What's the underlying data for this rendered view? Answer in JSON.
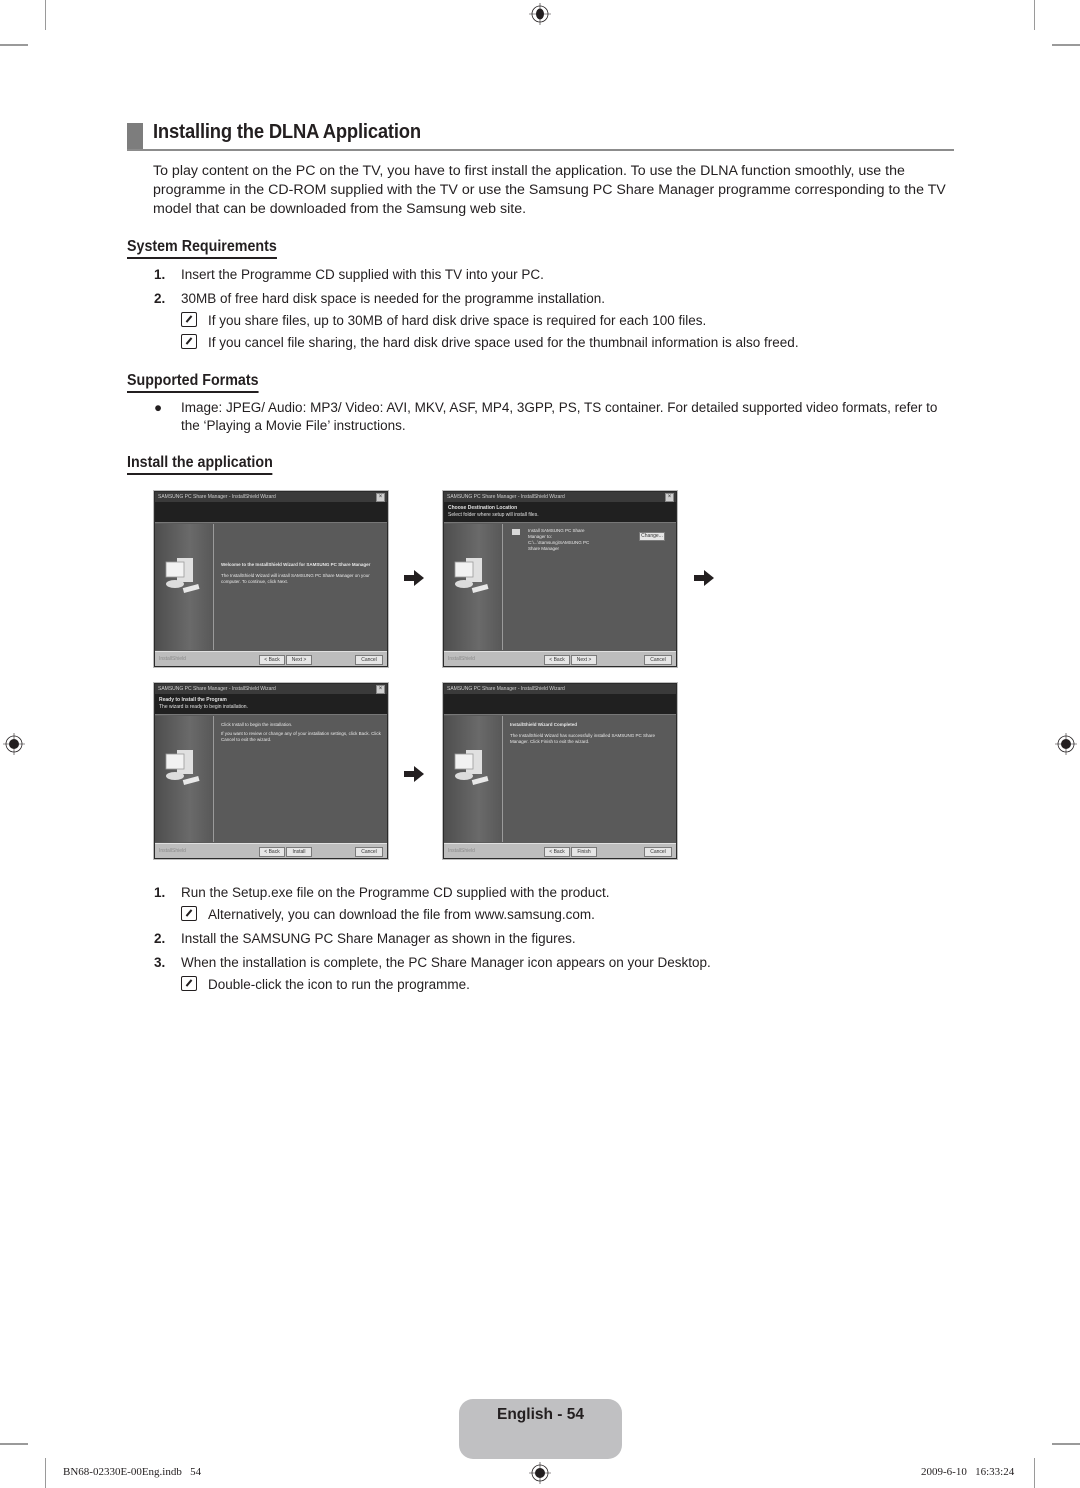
{
  "heading": {
    "title": "Installing the DLNA Application",
    "intro": "To play content on the PC on the TV, you have to first install the application. To use the DLNA function smoothly, use the programme in the CD-ROM supplied with the TV or use the Samsung PC Share Manager programme corresponding to the TV model that can be downloaded from the Samsung web site."
  },
  "system_requirements": {
    "title": "System Requirements",
    "items": [
      {
        "num": "1.",
        "text": "Insert the Programme CD supplied with this TV into your PC."
      },
      {
        "num": "2.",
        "text": "30MB of free hard disk space is needed for the programme installation."
      }
    ],
    "notes": [
      "If you share files, up to 30MB of hard disk drive space is required for each 100 files.",
      "If you cancel file sharing, the hard disk drive space used for the thumbnail information is also freed."
    ]
  },
  "supported_formats": {
    "title": "Supported Formats",
    "bullet_symbol": "●",
    "text": "Image: JPEG/ Audio: MP3/ Video: AVI, MKV, ASF, MP4, 3GPP, PS, TS container. For detailed supported video formats, refer to the ‘Playing a Movie File’ instructions."
  },
  "install_app": {
    "title": "Install the application",
    "wizards": [
      {
        "window_title": "SAMSUNG PC Share Manager - InstallShield Wizard",
        "banner_title": "",
        "banner_sub": "",
        "body_lines": [
          "Welcome to the InstallShield Wizard for SAMSUNG PC Share Manager",
          "The InstallShield Wizard will install SAMSUNG PC Share Manager on your computer. To continue, click Next."
        ],
        "buttons": {
          "back": "< Back",
          "next": "Next >",
          "cancel": "Cancel"
        },
        "brand": "InstallShield"
      },
      {
        "window_title": "SAMSUNG PC Share Manager - InstallShield Wizard",
        "banner_title": "Choose Destination Location",
        "banner_sub": "Select folder where setup will install files.",
        "body_lines": [
          "Install SAMSUNG PC Share Manager to:",
          "C:\\...\\Samsung\\SAMSUNG PC Share Manager"
        ],
        "change_button": "Change...",
        "buttons": {
          "back": "< Back",
          "next": "Next >",
          "cancel": "Cancel"
        },
        "brand": "InstallShield"
      },
      {
        "window_title": "SAMSUNG PC Share Manager - InstallShield Wizard",
        "banner_title": "Ready to Install the Program",
        "banner_sub": "The wizard is ready to begin installation.",
        "body_lines": [
          "Click Install to begin the installation.",
          "If you want to review or change any of your installation settings, click Back. Click Cancel to exit the wizard."
        ],
        "buttons": {
          "back": "< Back",
          "next": "Install",
          "cancel": "Cancel"
        },
        "brand": "InstallShield"
      },
      {
        "window_title": "SAMSUNG PC Share Manager - InstallShield Wizard",
        "banner_title": "",
        "banner_sub": "",
        "body_lines": [
          "InstallShield Wizard Completed",
          "The InstallShield Wizard has successfully installed SAMSUNG PC Share Manager. Click Finish to exit the wizard."
        ],
        "buttons": {
          "back": "< Back",
          "next": "Finish",
          "cancel": "Cancel"
        },
        "brand": "InstallShield"
      }
    ],
    "steps": [
      {
        "num": "1.",
        "text": "Run the Setup.exe file on the Programme CD supplied with the product."
      },
      {
        "note": "Alternatively, you can download the file from www.samsung.com."
      },
      {
        "num": "2.",
        "text": "Install the SAMSUNG PC Share Manager as shown in the figures."
      },
      {
        "num": "3.",
        "text": "When the installation is complete, the PC Share Manager icon appears on your Desktop."
      },
      {
        "note": "Double-click the icon to run the programme."
      }
    ]
  },
  "footer": {
    "page_label": "English - 54",
    "file_slug": "BN68-02330E-00Eng.indb   54",
    "timestamp": "2009-6-10   16:33:24"
  },
  "colors": {
    "heading_bar": "#7d7d7d",
    "page_tab": "#c0c0c2",
    "text": "#231f20",
    "wizard_bg": "#5a5a5a"
  }
}
